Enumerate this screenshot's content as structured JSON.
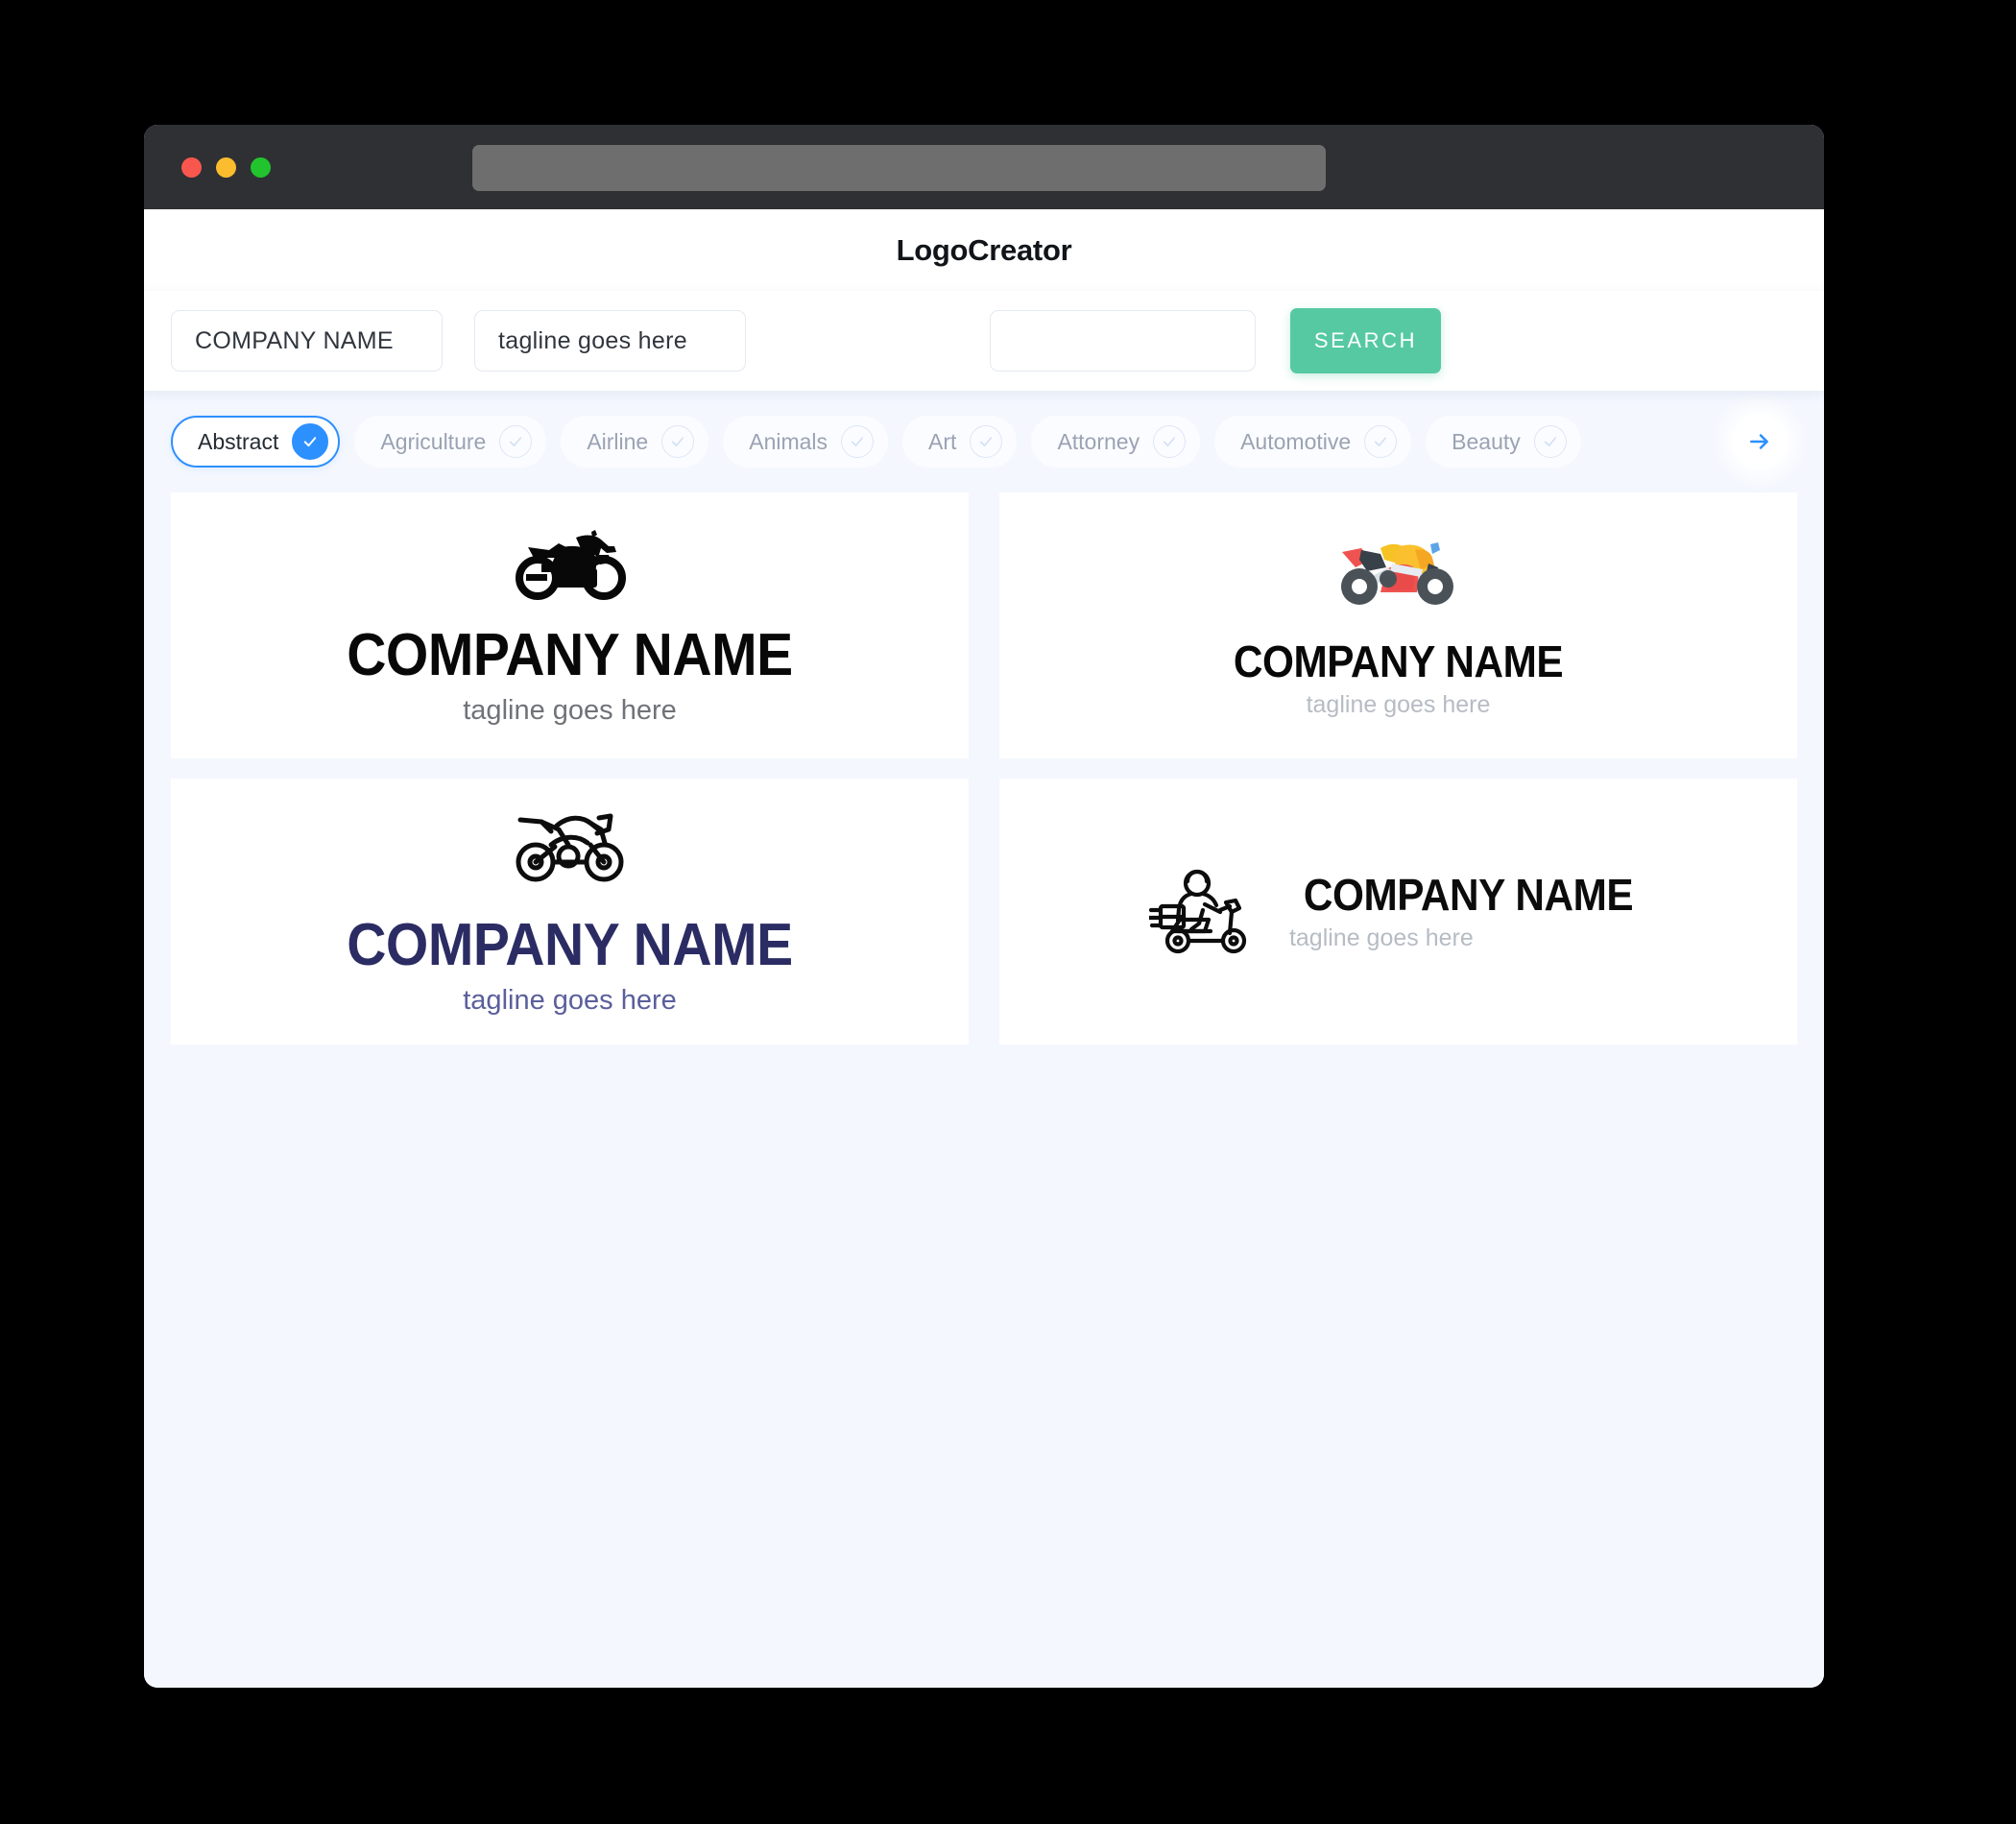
{
  "window": {
    "traffic_lights": [
      {
        "name": "close",
        "color": "#f9574e"
      },
      {
        "name": "minimize",
        "color": "#fbbd2d"
      },
      {
        "name": "maximize",
        "color": "#22c42e"
      }
    ],
    "url_value": ""
  },
  "header": {
    "title": "LogoCreator"
  },
  "search": {
    "company_value": "COMPANY NAME",
    "tagline_value": "tagline goes here",
    "extra_value": "",
    "extra_placeholder": "",
    "button_label": "SEARCH",
    "button_color": "#56c9a3"
  },
  "categories": {
    "accent_color": "#2d90ff",
    "next_label": "next",
    "items": [
      {
        "label": "Abstract",
        "selected": true
      },
      {
        "label": "Agriculture",
        "selected": false
      },
      {
        "label": "Airline",
        "selected": false
      },
      {
        "label": "Animals",
        "selected": false
      },
      {
        "label": "Art",
        "selected": false
      },
      {
        "label": "Attorney",
        "selected": false
      },
      {
        "label": "Automotive",
        "selected": false
      },
      {
        "label": "Beauty",
        "selected": false
      }
    ]
  },
  "logos": [
    {
      "icon": "motorcycle-silhouette-icon",
      "name": "COMPANY NAME",
      "tagline": "tagline goes here",
      "name_color": "#080808",
      "tagline_color": "#6f7378",
      "layout": "stacked"
    },
    {
      "icon": "motorcycle-color-flat-icon",
      "name": "COMPANY NAME",
      "tagline": "tagline goes here",
      "name_color": "#080808",
      "tagline_color": "#b6bcc4",
      "layout": "stacked"
    },
    {
      "icon": "motorcycle-outline-icon",
      "name": "COMPANY NAME",
      "tagline": "tagline goes here",
      "name_color": "#2b2c63",
      "tagline_color": "#5b5f9b",
      "layout": "stacked"
    },
    {
      "icon": "delivery-scooter-rider-icon",
      "name": "COMPANY NAME",
      "tagline": "tagline goes here",
      "name_color": "#0c0c0c",
      "tagline_color": "#b6bcc4",
      "layout": "horizontal"
    }
  ]
}
